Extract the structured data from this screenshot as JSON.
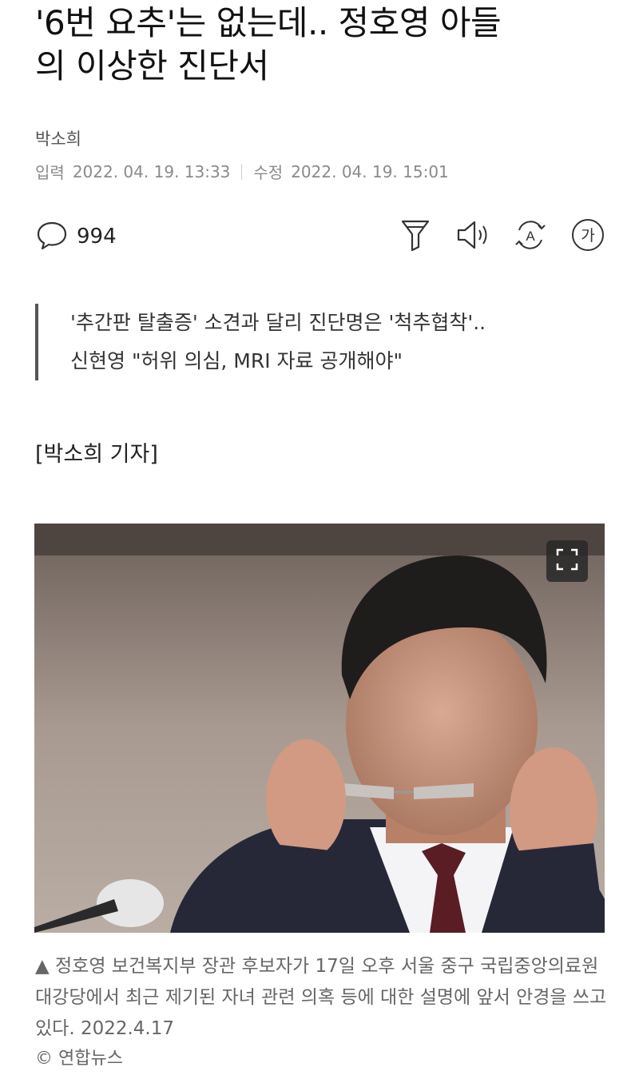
{
  "article": {
    "headline_line1": "'6번 요추'는 없는데.. 정호영 아들",
    "headline_line2": "의 이상한 진단서",
    "reporter": "박소희",
    "input_label": "입력",
    "input_date": "2022. 04. 19. 13:33",
    "modified_label": "수정",
    "modified_date": "2022. 04. 19. 15:01"
  },
  "toolbar": {
    "comment_count": "994",
    "icons": [
      "comment-icon",
      "filter-icon",
      "speaker-icon",
      "translate-icon",
      "font-size-icon"
    ],
    "font_glyph": "가",
    "translate_glyph": "A"
  },
  "subheadline": {
    "line1": "'추간판 탈출증' 소견과 달리 진단명은 '척추협착'..",
    "line2": "신현영 \"허위 의심, MRI 자료 공개해야\""
  },
  "byline": "[박소희 기자]",
  "photo": {
    "caption": "▲  정호영 보건복지부 장관 후보자가 17일 오후 서울 중구 국립중앙의료원 대강당에서 최근 제기된 자녀 관련 의혹 등에 대한 설명에 앞서 안경을 쓰고 있다. 2022.4.17",
    "credit": "© 연합뉴스"
  },
  "colors": {
    "text": "#111111",
    "meta": "#8a8a8a",
    "caption": "#666666",
    "accent_bar": "#555555"
  }
}
